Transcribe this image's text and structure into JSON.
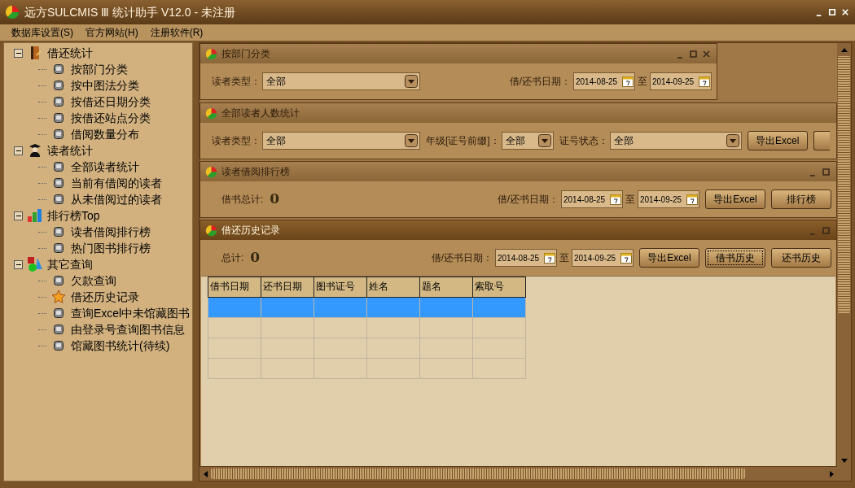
{
  "window": {
    "title": "远方SULCMIS Ⅲ 统计助手 V12.0 - 未注册"
  },
  "menu": [
    "数据库设置(S)",
    "官方网站(H)",
    "注册软件(R)"
  ],
  "tree": [
    {
      "label": "借还统计",
      "kind": "book",
      "expanded": true,
      "children": [
        {
          "label": "按部门分类",
          "kind": "bullet"
        },
        {
          "label": "按中图法分类",
          "kind": "bullet"
        },
        {
          "label": "按借还日期分类",
          "kind": "bullet"
        },
        {
          "label": "按借还站点分类",
          "kind": "bullet"
        },
        {
          "label": "借阅数量分布",
          "kind": "bullet"
        }
      ]
    },
    {
      "label": "读者统计",
      "kind": "reader",
      "expanded": true,
      "children": [
        {
          "label": "全部读者统计",
          "kind": "bullet"
        },
        {
          "label": "当前有借阅的读者",
          "kind": "bullet"
        },
        {
          "label": "从未借阅过的读者",
          "kind": "bullet"
        }
      ]
    },
    {
      "label": "排行榜Top",
      "kind": "chart",
      "expanded": true,
      "children": [
        {
          "label": "读者借阅排行榜",
          "kind": "bullet"
        },
        {
          "label": "热门图书排行榜",
          "kind": "bullet"
        }
      ]
    },
    {
      "label": "其它查询",
      "kind": "shapes",
      "expanded": true,
      "children": [
        {
          "label": "欠款查询",
          "kind": "bullet"
        },
        {
          "label": "借还历史记录",
          "kind": "star"
        },
        {
          "label": "查询Excel中未馆藏图书",
          "kind": "bullet"
        },
        {
          "label": "由登录号查询图书信息",
          "kind": "bullet"
        },
        {
          "label": "馆藏图书统计(待续)",
          "kind": "bullet"
        }
      ]
    }
  ],
  "child_windows": [
    {
      "title": "按部门分类",
      "active": false,
      "controls": {
        "minimize": true,
        "maximize": true,
        "close": true
      },
      "fields": [
        {
          "kind": "select",
          "label": "读者类型：",
          "value": "全部"
        },
        {
          "kind": "date_range",
          "label": "借/还书日期：",
          "from": "2014-08-25",
          "sep": "至",
          "to": "2014-09-25"
        }
      ]
    },
    {
      "title": "全部读者人数统计",
      "active": false,
      "fields": [
        {
          "kind": "select",
          "label": "读者类型：",
          "value": "全部"
        },
        {
          "kind": "select",
          "label": "年级[证号前缀]：",
          "value": "全部"
        },
        {
          "kind": "select",
          "label": "证号状态：",
          "value": "全部"
        },
        {
          "kind": "button",
          "label": "导出Excel",
          "focused": false
        },
        {
          "kind": "button_cut"
        }
      ]
    },
    {
      "title": "读者借阅排行榜",
      "active": false,
      "controls": {
        "minimize": true,
        "maximize": true,
        "close": false
      },
      "fields": [
        {
          "kind": "stat",
          "label": "借书总计:",
          "value": "0"
        },
        {
          "kind": "date_range",
          "label": "借/还书日期：",
          "from": "2014-08-25",
          "sep": "至",
          "to": "2014-09-25"
        },
        {
          "kind": "button",
          "label": "导出Excel",
          "focused": false
        },
        {
          "kind": "button",
          "label": "排行榜",
          "focused": false
        }
      ]
    },
    {
      "title": "借还历史记录",
      "active": true,
      "controls": {
        "minimize": true,
        "maximize": true,
        "close": false
      },
      "fields": [
        {
          "kind": "stat",
          "label": "总计:",
          "value": "0"
        },
        {
          "kind": "date_range",
          "label": "借/还书日期：",
          "from": "2014-08-25",
          "sep": "至",
          "to": "2014-09-25"
        },
        {
          "kind": "button",
          "label": "导出Excel",
          "focused": false
        },
        {
          "kind": "button",
          "label": "借书历史",
          "focused": true
        },
        {
          "kind": "button",
          "label": "还书历史",
          "focused": false
        }
      ],
      "table": {
        "columns": [
          "借书日期",
          "还书日期",
          "图书证号",
          "姓名",
          "题名",
          "索取号"
        ],
        "rows": [
          {
            "selected": true
          },
          {
            "selected": false
          },
          {
            "selected": false
          },
          {
            "selected": false
          }
        ]
      }
    }
  ]
}
